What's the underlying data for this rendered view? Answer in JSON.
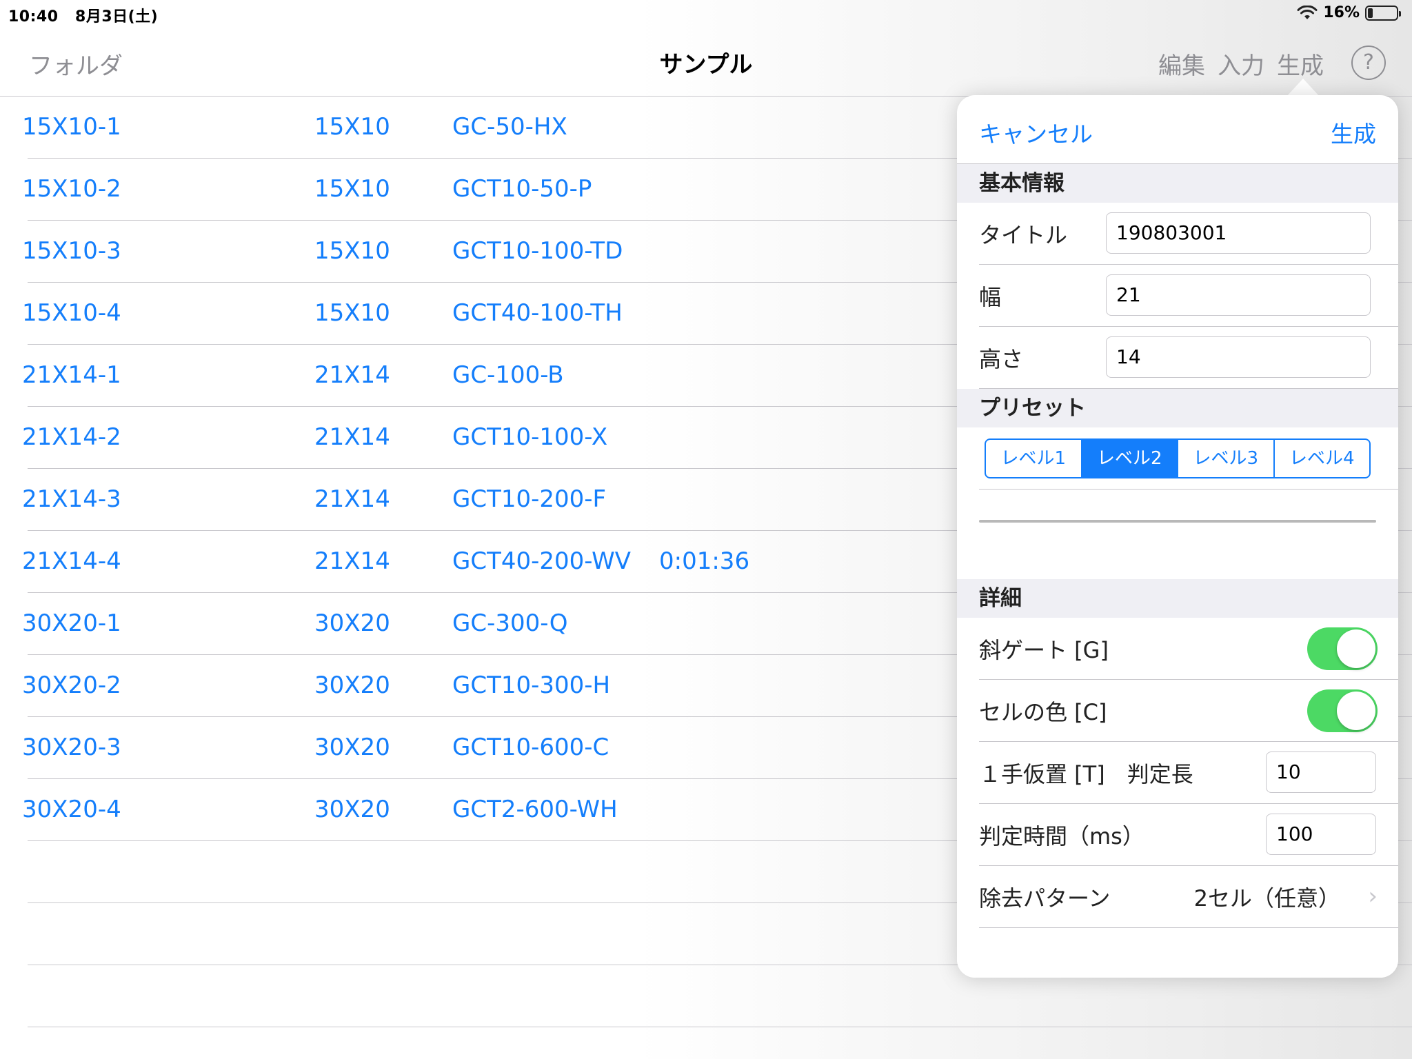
{
  "status_bar": {
    "time": "10:40",
    "date": "8月3日(土)",
    "battery": "16%",
    "battery_level": 0.16
  },
  "nav": {
    "back_label": "フォルダ",
    "title": "サンプル",
    "edit_label": "編集",
    "input_label": "入力",
    "generate_label": "生成",
    "help_label": "?"
  },
  "list": [
    {
      "name": "15X10-1",
      "size": "15X10",
      "code": "GC-50-HX",
      "time": ""
    },
    {
      "name": "15X10-2",
      "size": "15X10",
      "code": "GCT10-50-P",
      "time": ""
    },
    {
      "name": "15X10-3",
      "size": "15X10",
      "code": "GCT10-100-TD",
      "time": ""
    },
    {
      "name": "15X10-4",
      "size": "15X10",
      "code": "GCT40-100-TH",
      "time": ""
    },
    {
      "name": "21X14-1",
      "size": "21X14",
      "code": "GC-100-B",
      "time": ""
    },
    {
      "name": "21X14-2",
      "size": "21X14",
      "code": "GCT10-100-X",
      "time": ""
    },
    {
      "name": "21X14-3",
      "size": "21X14",
      "code": "GCT10-200-F",
      "time": ""
    },
    {
      "name": "21X14-4",
      "size": "21X14",
      "code": "GCT40-200-WV",
      "time": "0:01:36"
    },
    {
      "name": "30X20-1",
      "size": "30X20",
      "code": "GC-300-Q",
      "time": ""
    },
    {
      "name": "30X20-2",
      "size": "30X20",
      "code": "GCT10-300-H",
      "time": ""
    },
    {
      "name": "30X20-3",
      "size": "30X20",
      "code": "GCT10-600-C",
      "time": ""
    },
    {
      "name": "30X20-4",
      "size": "30X20",
      "code": "GCT2-600-WH",
      "time": ""
    }
  ],
  "popover": {
    "cancel_label": "キャンセル",
    "generate_label": "生成",
    "basic_section": "基本情報",
    "title_label": "タイトル",
    "title_value": "190803001",
    "width_label": "幅",
    "width_value": "21",
    "height_label": "高さ",
    "height_value": "14",
    "preset_section": "プリセット",
    "presets": [
      "レベル1",
      "レベル2",
      "レベル3",
      "レベル4"
    ],
    "preset_selected": 1,
    "detail_section": "詳細",
    "diagonal_gate_label": "斜ゲート [G]",
    "diagonal_gate_on": true,
    "cell_color_label": "セルの色 [C]",
    "cell_color_on": true,
    "tentative_label": "１手仮置 [T]　判定長",
    "tentative_value": "10",
    "judge_time_label": "判定時間（ms）",
    "judge_time_value": "100",
    "removal_label": "除去パターン",
    "removal_value": "2セル（任意）"
  },
  "colors": {
    "accent": "#147efb",
    "toggle_on": "#4cd964",
    "nav_gray": "#8e8e93"
  }
}
